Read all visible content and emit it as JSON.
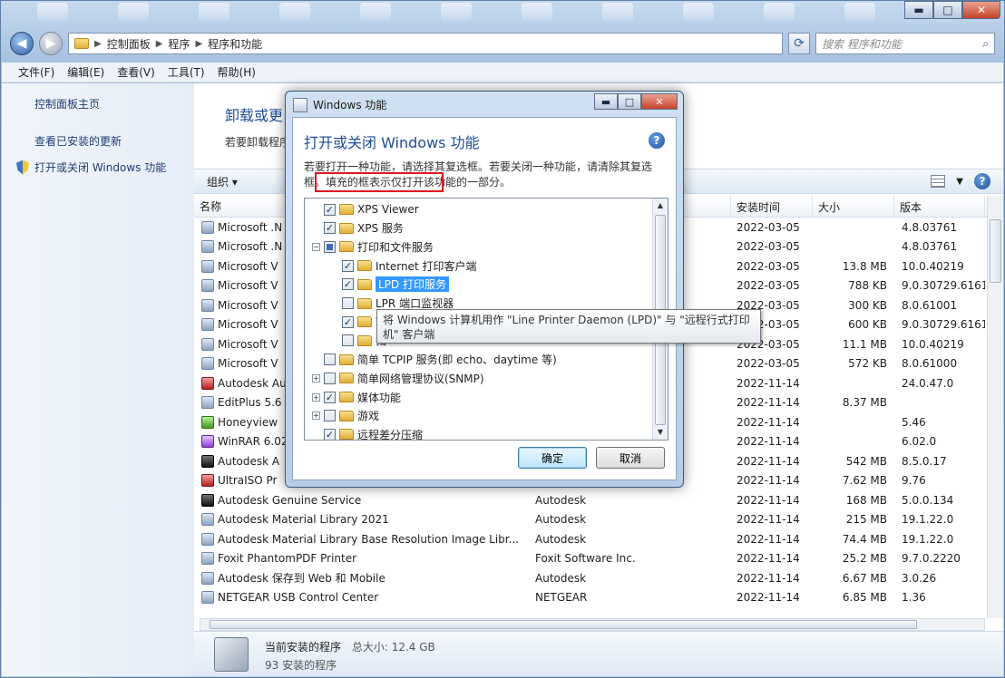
{
  "window": {
    "buttons": {
      "minimize": "▬",
      "maximize": "□",
      "close": "✕"
    }
  },
  "address": {
    "breadcrumbs": [
      "控制面板",
      "程序",
      "程序和功能"
    ],
    "search_placeholder": "搜索 程序和功能"
  },
  "menubar": [
    "文件(F)",
    "编辑(E)",
    "查看(V)",
    "工具(T)",
    "帮助(H)"
  ],
  "leftpane": {
    "home": "控制面板主页",
    "updates": "查看已安装的更新",
    "features": "打开或关闭 Windows 功能"
  },
  "content": {
    "heading": "卸载或更",
    "subtext": "若要卸载程序",
    "organize": "组织 ▾"
  },
  "table": {
    "headers": {
      "name": "名称",
      "date": "安装时间",
      "size": "大小",
      "version": "版本"
    },
    "rows": [
      {
        "name": "Microsoft .N",
        "publisher": "",
        "date": "2022-03-05",
        "size": "",
        "version": "4.8.03761",
        "icon": "app"
      },
      {
        "name": "Microsoft .N",
        "publisher": "",
        "date": "2022-03-05",
        "size": "",
        "version": "4.8.03761",
        "icon": "app"
      },
      {
        "name": "Microsoft V",
        "publisher": "",
        "date": "2022-03-05",
        "size": "13.8 MB",
        "version": "10.0.40219",
        "icon": "app"
      },
      {
        "name": "Microsoft V",
        "publisher": "",
        "date": "2022-03-05",
        "size": "788 KB",
        "version": "9.0.30729.6161",
        "icon": "app"
      },
      {
        "name": "Microsoft V",
        "publisher": "",
        "date": "2022-03-05",
        "size": "300 KB",
        "version": "8.0.61001",
        "icon": "app"
      },
      {
        "name": "Microsoft V",
        "publisher": "",
        "date": "2022-03-05",
        "size": "600 KB",
        "version": "9.0.30729.6161",
        "icon": "app"
      },
      {
        "name": "Microsoft V",
        "publisher": "",
        "date": "2022-03-05",
        "size": "11.1 MB",
        "version": "10.0.40219",
        "icon": "app"
      },
      {
        "name": "Microsoft V",
        "publisher": "",
        "date": "2022-03-05",
        "size": "572 KB",
        "version": "8.0.61000",
        "icon": "app"
      },
      {
        "name": "Autodesk Au",
        "publisher": "",
        "date": "2022-11-14",
        "size": "",
        "version": "24.0.47.0",
        "icon": "red"
      },
      {
        "name": "EditPlus 5.6",
        "publisher": "",
        "date": "2022-11-14",
        "size": "8.37 MB",
        "version": "",
        "icon": "app"
      },
      {
        "name": "Honeyview",
        "publisher": "",
        "date": "2022-11-14",
        "size": "",
        "version": "5.46",
        "icon": "green"
      },
      {
        "name": "WinRAR 6.02",
        "publisher": "",
        "date": "2022-11-14",
        "size": "",
        "version": "6.02.0",
        "icon": "purple"
      },
      {
        "name": "Autodesk A",
        "publisher": "",
        "date": "2022-11-14",
        "size": "542 MB",
        "version": "8.5.0.17",
        "icon": "dark"
      },
      {
        "name": "UltraISO Pr",
        "publisher": "",
        "date": "2022-11-14",
        "size": "7.62 MB",
        "version": "9.76",
        "icon": "red"
      },
      {
        "name": "Autodesk Genuine Service",
        "publisher": "Autodesk",
        "date": "2022-11-14",
        "size": "168 MB",
        "version": "5.0.0.134",
        "icon": "dark"
      },
      {
        "name": "Autodesk Material Library 2021",
        "publisher": "Autodesk",
        "date": "2022-11-14",
        "size": "215 MB",
        "version": "19.1.22.0",
        "icon": "app"
      },
      {
        "name": "Autodesk Material Library Base Resolution Image Libr...",
        "publisher": "Autodesk",
        "date": "2022-11-14",
        "size": "74.4 MB",
        "version": "19.1.22.0",
        "icon": "app"
      },
      {
        "name": "Foxit PhantomPDF Printer",
        "publisher": "Foxit Software Inc.",
        "date": "2022-11-14",
        "size": "25.2 MB",
        "version": "9.7.0.2220",
        "icon": "app"
      },
      {
        "name": "Autodesk 保存到 Web 和 Mobile",
        "publisher": "Autodesk",
        "date": "2022-11-14",
        "size": "6.67 MB",
        "version": "3.0.26",
        "icon": "app"
      },
      {
        "name": "NETGEAR USB Control Center",
        "publisher": "NETGEAR",
        "date": "2022-11-14",
        "size": "6.85 MB",
        "version": "1.36",
        "icon": "app"
      }
    ]
  },
  "statusbar": {
    "title": "当前安装的程序",
    "total": "总大小: 12.4 GB",
    "count": "93 安装的程序"
  },
  "dialog": {
    "title": "Windows 功能",
    "heading": "打开或关闭 Windows 功能",
    "description": "若要打开一种功能，请选择其复选框。若要关闭一种功能，请清除其复选框。填充的框表示仅打开该功能的一部分。",
    "tree": [
      {
        "label": "XPS Viewer",
        "checked": true,
        "partial": false,
        "level": 0,
        "expander": ""
      },
      {
        "label": "XPS 服务",
        "checked": true,
        "partial": false,
        "level": 0,
        "expander": ""
      },
      {
        "label": "打印和文件服务",
        "checked": false,
        "partial": true,
        "level": 0,
        "expander": "−"
      },
      {
        "label": "Internet 打印客户端",
        "checked": true,
        "partial": false,
        "level": 1,
        "expander": ""
      },
      {
        "label": "LPD 打印服务",
        "checked": true,
        "partial": false,
        "level": 1,
        "expander": "",
        "selected": true
      },
      {
        "label": "LPR 端口监视器",
        "checked": false,
        "partial": false,
        "level": 1,
        "expander": ""
      },
      {
        "label": "W",
        "checked": true,
        "partial": false,
        "level": 1,
        "expander": ""
      },
      {
        "label": "扫",
        "checked": false,
        "partial": false,
        "level": 1,
        "expander": ""
      },
      {
        "label": "简单 TCPIP 服务(即 echo、daytime 等)",
        "checked": false,
        "partial": false,
        "level": 0,
        "expander": ""
      },
      {
        "label": "简单网络管理协议(SNMP)",
        "checked": false,
        "partial": false,
        "level": 0,
        "expander": "+"
      },
      {
        "label": "媒体功能",
        "checked": true,
        "partial": false,
        "level": 0,
        "expander": "+"
      },
      {
        "label": "游戏",
        "checked": false,
        "partial": false,
        "level": 0,
        "expander": "+"
      },
      {
        "label": "远程差分压缩",
        "checked": true,
        "partial": false,
        "level": 0,
        "expander": ""
      }
    ],
    "tooltip": "将 Windows 计算机用作 \"Line Printer Daemon (LPD)\" 与 \"远程行式打印机\" 客户端",
    "ok": "确定",
    "cancel": "取消"
  }
}
